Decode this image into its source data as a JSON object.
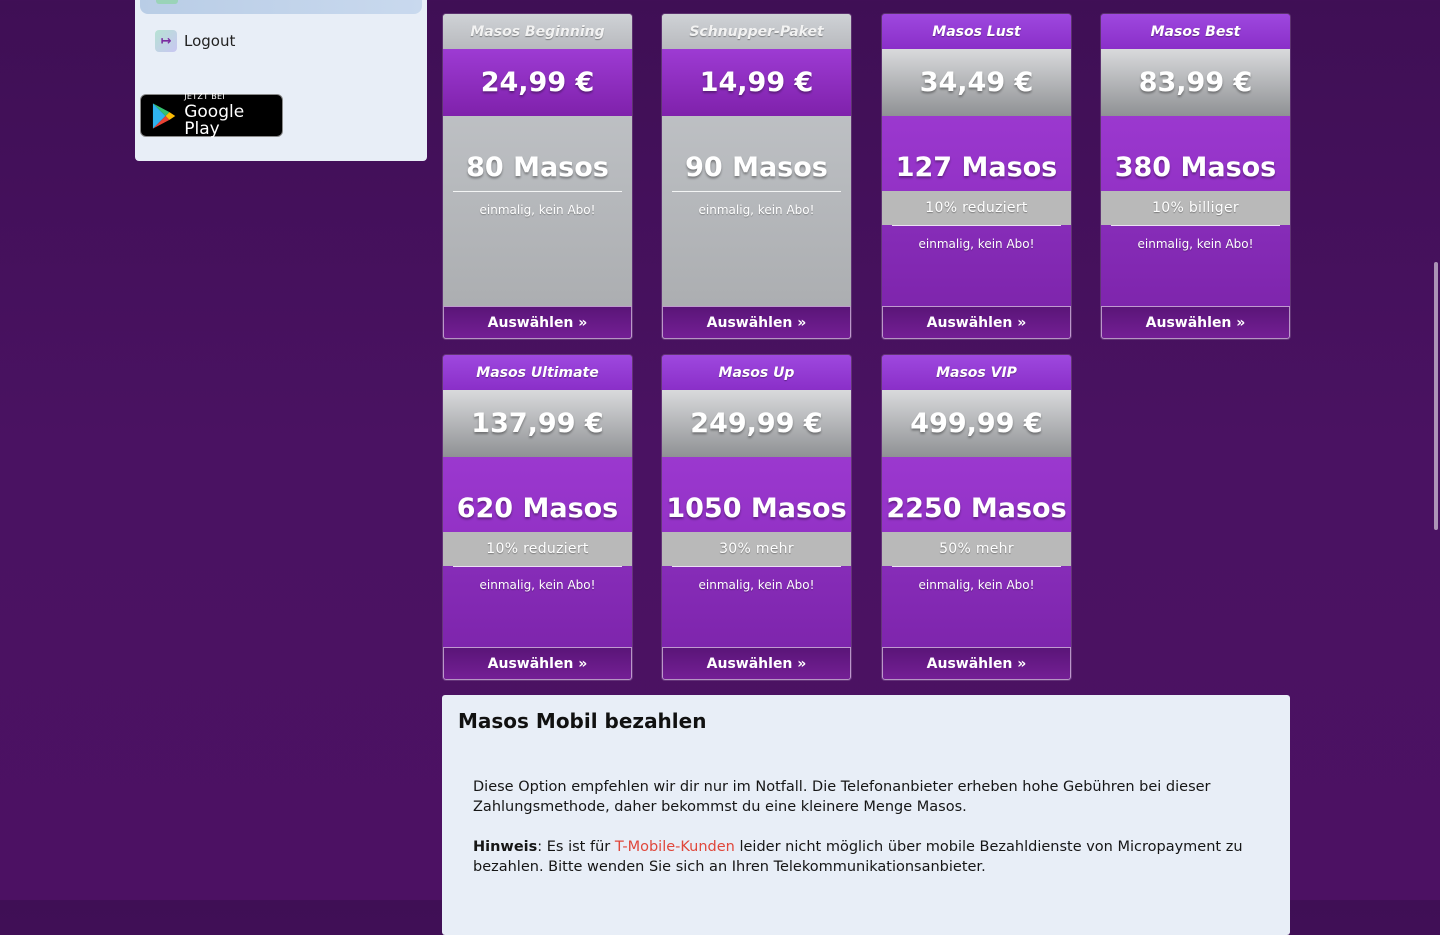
{
  "sidebar": {
    "logout_label": "Logout",
    "google_play": {
      "small": "JETZT BEI",
      "big": "Google Play"
    }
  },
  "packages": [
    {
      "title": "Masos Beginning",
      "price": "24,99 €",
      "amount": "80 Masos",
      "badge": "",
      "note": "einmalig, kein Abo!",
      "button": "Auswählen »"
    },
    {
      "title": "Schnupper-Paket",
      "price": "14,99 €",
      "amount": "90 Masos",
      "badge": "",
      "note": "einmalig, kein Abo!",
      "button": "Auswählen »"
    },
    {
      "title": "Masos Lust",
      "price": "34,49 €",
      "amount": "127 Masos",
      "badge": "10% reduziert",
      "note": "einmalig, kein Abo!",
      "button": "Auswählen »"
    },
    {
      "title": "Masos Best",
      "price": "83,99 €",
      "amount": "380 Masos",
      "badge": "10% billiger",
      "note": "einmalig, kein Abo!",
      "button": "Auswählen »"
    },
    {
      "title": "Masos Ultimate",
      "price": "137,99 €",
      "amount": "620 Masos",
      "badge": "10% reduziert",
      "note": "einmalig, kein Abo!",
      "button": "Auswählen »"
    },
    {
      "title": "Masos Up",
      "price": "249,99 €",
      "amount": "1050 Masos",
      "badge": "30% mehr",
      "note": "einmalig, kein Abo!",
      "button": "Auswählen »"
    },
    {
      "title": "Masos VIP",
      "price": "499,99 €",
      "amount": "2250 Masos",
      "badge": "50% mehr",
      "note": "einmalig, kein Abo!",
      "button": "Auswählen »"
    }
  ],
  "mobile_pay": {
    "heading": "Masos Mobil bezahlen",
    "paragraph1": "Diese Option empfehlen wir dir nur im Notfall. Die Telefonanbieter erheben hohe Gebühren bei dieser Zahlungsmethode, daher bekommst du eine kleinere Menge Masos.",
    "hint_label": "Hinweis",
    "hint_pre": ": Es ist für ",
    "hint_link": "T-Mobile-Kunden",
    "hint_post": " leider nicht möglich über mobile Bezahldienste von Micropayment zu bezahlen. Bitte wenden Sie sich an Ihren Telekommunikationsanbieter."
  },
  "colors": {
    "background": "#4a1262",
    "card_purple": "#9332c6",
    "card_grey": "#b9b9b9",
    "hint_link": "#e0473b",
    "panel": "#e8eef7"
  }
}
